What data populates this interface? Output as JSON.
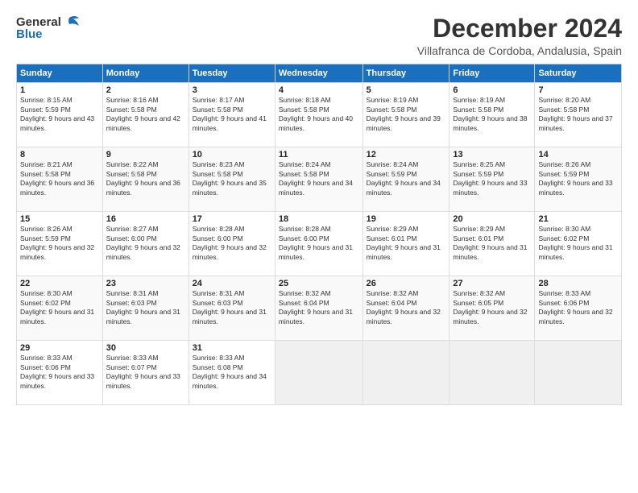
{
  "logo": {
    "line1": "General",
    "line2": "Blue"
  },
  "header": {
    "month_year": "December 2024",
    "location": "Villafranca de Cordoba, Andalusia, Spain"
  },
  "weekdays": [
    "Sunday",
    "Monday",
    "Tuesday",
    "Wednesday",
    "Thursday",
    "Friday",
    "Saturday"
  ],
  "weeks": [
    [
      {
        "day": "1",
        "sunrise": "8:15 AM",
        "sunset": "5:59 PM",
        "daylight": "9 hours and 43 minutes."
      },
      {
        "day": "2",
        "sunrise": "8:16 AM",
        "sunset": "5:58 PM",
        "daylight": "9 hours and 42 minutes."
      },
      {
        "day": "3",
        "sunrise": "8:17 AM",
        "sunset": "5:58 PM",
        "daylight": "9 hours and 41 minutes."
      },
      {
        "day": "4",
        "sunrise": "8:18 AM",
        "sunset": "5:58 PM",
        "daylight": "9 hours and 40 minutes."
      },
      {
        "day": "5",
        "sunrise": "8:19 AM",
        "sunset": "5:58 PM",
        "daylight": "9 hours and 39 minutes."
      },
      {
        "day": "6",
        "sunrise": "8:19 AM",
        "sunset": "5:58 PM",
        "daylight": "9 hours and 38 minutes."
      },
      {
        "day": "7",
        "sunrise": "8:20 AM",
        "sunset": "5:58 PM",
        "daylight": "9 hours and 37 minutes."
      }
    ],
    [
      {
        "day": "8",
        "sunrise": "8:21 AM",
        "sunset": "5:58 PM",
        "daylight": "9 hours and 36 minutes."
      },
      {
        "day": "9",
        "sunrise": "8:22 AM",
        "sunset": "5:58 PM",
        "daylight": "9 hours and 36 minutes."
      },
      {
        "day": "10",
        "sunrise": "8:23 AM",
        "sunset": "5:58 PM",
        "daylight": "9 hours and 35 minutes."
      },
      {
        "day": "11",
        "sunrise": "8:24 AM",
        "sunset": "5:58 PM",
        "daylight": "9 hours and 34 minutes."
      },
      {
        "day": "12",
        "sunrise": "8:24 AM",
        "sunset": "5:59 PM",
        "daylight": "9 hours and 34 minutes."
      },
      {
        "day": "13",
        "sunrise": "8:25 AM",
        "sunset": "5:59 PM",
        "daylight": "9 hours and 33 minutes."
      },
      {
        "day": "14",
        "sunrise": "8:26 AM",
        "sunset": "5:59 PM",
        "daylight": "9 hours and 33 minutes."
      }
    ],
    [
      {
        "day": "15",
        "sunrise": "8:26 AM",
        "sunset": "5:59 PM",
        "daylight": "9 hours and 32 minutes."
      },
      {
        "day": "16",
        "sunrise": "8:27 AM",
        "sunset": "6:00 PM",
        "daylight": "9 hours and 32 minutes."
      },
      {
        "day": "17",
        "sunrise": "8:28 AM",
        "sunset": "6:00 PM",
        "daylight": "9 hours and 32 minutes."
      },
      {
        "day": "18",
        "sunrise": "8:28 AM",
        "sunset": "6:00 PM",
        "daylight": "9 hours and 31 minutes."
      },
      {
        "day": "19",
        "sunrise": "8:29 AM",
        "sunset": "6:01 PM",
        "daylight": "9 hours and 31 minutes."
      },
      {
        "day": "20",
        "sunrise": "8:29 AM",
        "sunset": "6:01 PM",
        "daylight": "9 hours and 31 minutes."
      },
      {
        "day": "21",
        "sunrise": "8:30 AM",
        "sunset": "6:02 PM",
        "daylight": "9 hours and 31 minutes."
      }
    ],
    [
      {
        "day": "22",
        "sunrise": "8:30 AM",
        "sunset": "6:02 PM",
        "daylight": "9 hours and 31 minutes."
      },
      {
        "day": "23",
        "sunrise": "8:31 AM",
        "sunset": "6:03 PM",
        "daylight": "9 hours and 31 minutes."
      },
      {
        "day": "24",
        "sunrise": "8:31 AM",
        "sunset": "6:03 PM",
        "daylight": "9 hours and 31 minutes."
      },
      {
        "day": "25",
        "sunrise": "8:32 AM",
        "sunset": "6:04 PM",
        "daylight": "9 hours and 31 minutes."
      },
      {
        "day": "26",
        "sunrise": "8:32 AM",
        "sunset": "6:04 PM",
        "daylight": "9 hours and 32 minutes."
      },
      {
        "day": "27",
        "sunrise": "8:32 AM",
        "sunset": "6:05 PM",
        "daylight": "9 hours and 32 minutes."
      },
      {
        "day": "28",
        "sunrise": "8:33 AM",
        "sunset": "6:06 PM",
        "daylight": "9 hours and 32 minutes."
      }
    ],
    [
      {
        "day": "29",
        "sunrise": "8:33 AM",
        "sunset": "6:06 PM",
        "daylight": "9 hours and 33 minutes."
      },
      {
        "day": "30",
        "sunrise": "8:33 AM",
        "sunset": "6:07 PM",
        "daylight": "9 hours and 33 minutes."
      },
      {
        "day": "31",
        "sunrise": "8:33 AM",
        "sunset": "6:08 PM",
        "daylight": "9 hours and 34 minutes."
      },
      null,
      null,
      null,
      null
    ]
  ]
}
